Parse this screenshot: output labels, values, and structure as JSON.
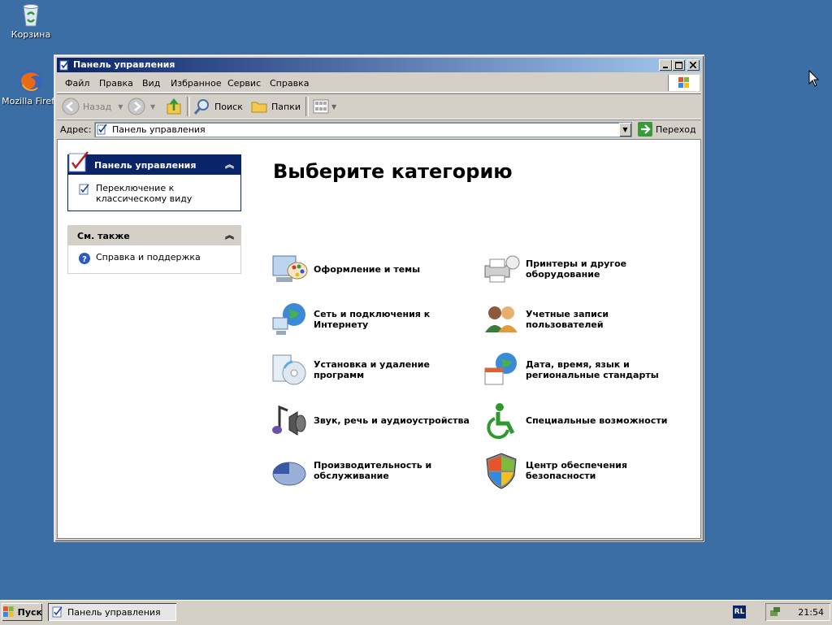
{
  "desktop": {
    "icons": [
      {
        "label": "Корзина",
        "icon": "recycle-bin-icon"
      },
      {
        "label": "Mozilla Firefo",
        "icon": "firefox-icon"
      }
    ]
  },
  "window": {
    "title": "Панель управления",
    "menu": [
      "Файл",
      "Правка",
      "Вид",
      "Избранное",
      "Сервис",
      "Справка"
    ],
    "toolbar": {
      "back": "Назад",
      "search": "Поиск",
      "folders": "Папки"
    },
    "address": {
      "label": "Адрес:",
      "value": "Панель управления",
      "go": "Переход"
    }
  },
  "task_pane": {
    "control_panel": {
      "title": "Панель управления",
      "link": "Переключение к классическому виду"
    },
    "see_also": {
      "title": "См. также",
      "link": "Справка и поддержка"
    }
  },
  "main": {
    "heading": "Выберите категорию",
    "categories_left": [
      {
        "label": "Оформление и темы",
        "icon": "appearance-themes-icon"
      },
      {
        "label": "Сеть и подключения к Интернету",
        "icon": "network-connections-icon"
      },
      {
        "label": "Установка и удаление программ",
        "icon": "add-remove-programs-icon"
      },
      {
        "label": "Звук, речь и аудиоустройства",
        "icon": "sound-speech-icon"
      },
      {
        "label": "Производительность и обслуживание",
        "icon": "performance-maintenance-icon"
      }
    ],
    "categories_right": [
      {
        "label": "Принтеры и другое оборудование",
        "icon": "printers-hardware-icon"
      },
      {
        "label": "Учетные записи пользователей",
        "icon": "user-accounts-icon"
      },
      {
        "label": "Дата, время, язык и региональные стандарты",
        "icon": "date-time-language-icon"
      },
      {
        "label": "Специальные возможности",
        "icon": "accessibility-icon"
      },
      {
        "label": "Центр обеспечения безопасности",
        "icon": "security-center-icon"
      }
    ]
  },
  "taskbar": {
    "start": "Пуск",
    "task": "Панель управления",
    "lang": "RL",
    "clock": "21:54"
  }
}
